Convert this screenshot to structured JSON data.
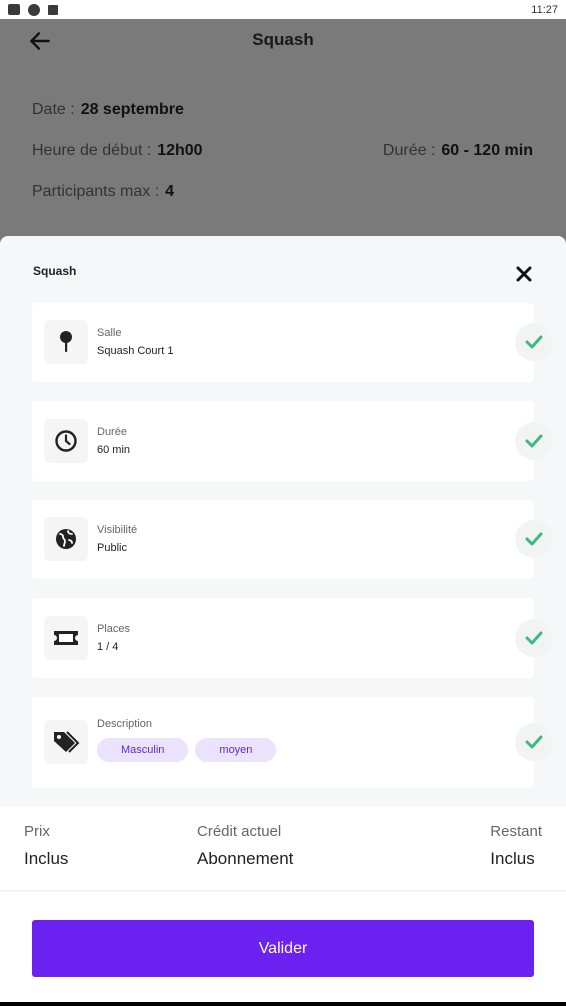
{
  "status_bar": {
    "time": "11:27"
  },
  "header": {
    "title": "Squash",
    "date_label": "Date :",
    "date_value": "28 septembre",
    "start_label": "Heure de début :",
    "start_value": "12h00",
    "duration_label": "Durée :",
    "duration_value": "60 - 120 min",
    "participants_label": "Participants max :",
    "participants_value": "4"
  },
  "sheet": {
    "title": "Squash",
    "items": [
      {
        "icon": "pin-icon",
        "label": "Salle",
        "value": "Squash Court 1"
      },
      {
        "icon": "clock-icon",
        "label": "Durée",
        "value": "60 min"
      },
      {
        "icon": "globe-icon",
        "label": "Visibilité",
        "value": "Public"
      },
      {
        "icon": "ticket-icon",
        "label": "Places",
        "value": "1 / 4"
      },
      {
        "icon": "tags-icon",
        "label": "Description",
        "chips": [
          "Masculin",
          "moyen"
        ]
      }
    ]
  },
  "summary": {
    "price_label": "Prix",
    "price_value": "Inclus",
    "credit_label": "Crédit actuel",
    "credit_value": "Abonnement",
    "remaining_label": "Restant",
    "remaining_value": "Inclus"
  },
  "actions": {
    "validate_label": "Valider"
  },
  "colors": {
    "accent": "#6b21ef",
    "check": "#3fb984",
    "chip_bg": "#ebe3fc",
    "chip_text": "#5b2cc7"
  }
}
